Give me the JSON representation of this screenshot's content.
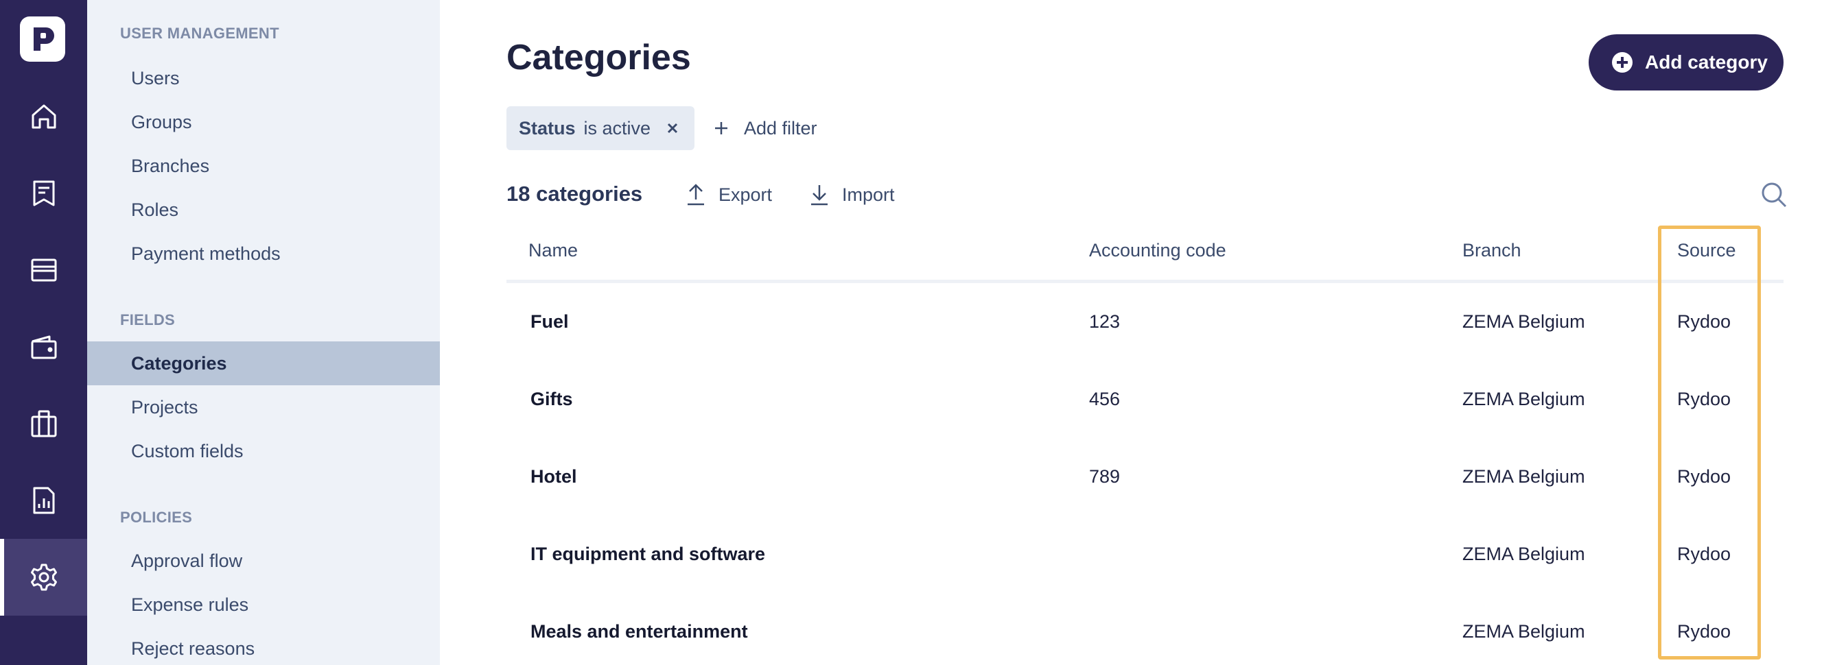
{
  "rail": {
    "items": [
      {
        "name": "home-icon"
      },
      {
        "name": "expenses-icon"
      },
      {
        "name": "cards-icon"
      },
      {
        "name": "wallet-icon"
      },
      {
        "name": "trips-icon"
      },
      {
        "name": "reports-icon"
      },
      {
        "name": "settings-icon",
        "active": true
      }
    ]
  },
  "sidebar": {
    "sections": [
      {
        "title": "USER MANAGEMENT",
        "items": [
          "Users",
          "Groups",
          "Branches",
          "Roles",
          "Payment methods"
        ]
      },
      {
        "title": "FIELDS",
        "items": [
          "Categories",
          "Projects",
          "Custom fields"
        ]
      },
      {
        "title": "POLICIES",
        "items": [
          "Approval flow",
          "Expense rules",
          "Reject reasons"
        ]
      }
    ],
    "active_item": "Categories"
  },
  "header": {
    "title": "Categories",
    "add_button": "Add category"
  },
  "filters": {
    "chip_key": "Status",
    "chip_value": "is active",
    "add_filter": "Add filter"
  },
  "toolbar": {
    "count": "18 categories",
    "export": "Export",
    "import": "Import"
  },
  "table": {
    "columns": [
      "Name",
      "Accounting code",
      "Branch",
      "Source"
    ],
    "rows": [
      {
        "name": "Fuel",
        "code": "123",
        "branch": "ZEMA Belgium",
        "source": "Rydoo"
      },
      {
        "name": "Gifts",
        "code": "456",
        "branch": "ZEMA Belgium",
        "source": "Rydoo"
      },
      {
        "name": "Hotel",
        "code": "789",
        "branch": "ZEMA Belgium",
        "source": "Rydoo"
      },
      {
        "name": "IT equipment and software",
        "code": "",
        "branch": "ZEMA Belgium",
        "source": "Rydoo"
      },
      {
        "name": "Meals and entertainment",
        "code": "",
        "branch": "ZEMA Belgium",
        "source": "Rydoo"
      }
    ]
  },
  "colors": {
    "brand": "#2c2558",
    "highlight": "#f3bd5d",
    "sidebar_bg": "#eef2f8",
    "active_item_bg": "#b8c5d8"
  }
}
